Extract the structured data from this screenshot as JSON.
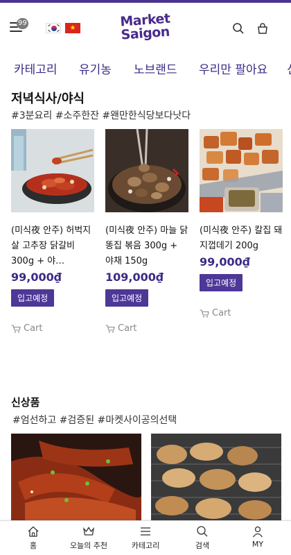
{
  "header": {
    "notification_count": "99",
    "logo_line1": "Market",
    "logo_line2": "Saigon"
  },
  "nav": {
    "items": [
      "카테고리",
      "유기농",
      "노브랜드",
      "우리만 팔아요",
      "신"
    ]
  },
  "section1": {
    "title": "저녁식사/야식",
    "tags": "#3분요리 #소주한잔 #왠만한식당보다낫다",
    "products": [
      {
        "name": "(미식夜 안주) 허벅지살 고추장 닭갈비 300g + 야…",
        "price": "99,000₫",
        "button": "입고예정",
        "cart": "Cart"
      },
      {
        "name": "(미식夜 안주) 마늘 닭똥집 볶음 300g + 야채 150g",
        "price": "109,000₫",
        "button": "입고예정",
        "cart": "Cart"
      },
      {
        "name": "(미식夜 안주) 칼집 돼지껍데기 200g",
        "price": "99,000₫",
        "button": "입고예정",
        "cart": "Cart"
      }
    ]
  },
  "section2": {
    "title": "신상품",
    "tags": "#엄선하고 #검증된 #마켓사이공의선택"
  },
  "bottom_nav": {
    "items": [
      "홈",
      "오늘의 추천",
      "카테고리",
      "검색",
      "MY"
    ]
  },
  "colors": {
    "brand": "#4a3390",
    "price": "#3d2a86",
    "button": "#4d3797"
  }
}
